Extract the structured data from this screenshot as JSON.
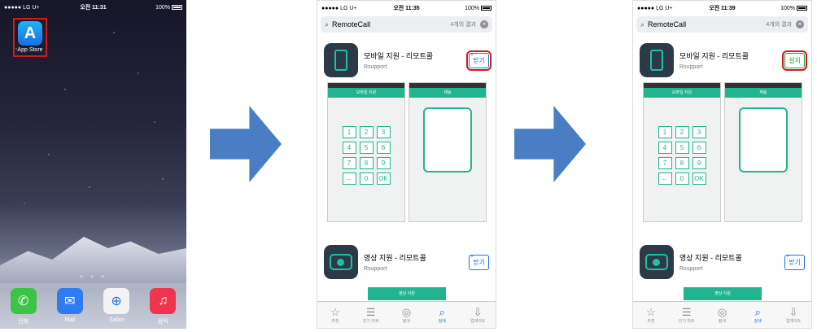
{
  "phone1": {
    "status": {
      "carrier": "●●●●● LG U+",
      "time": "오전 11:31",
      "battery": "100%"
    },
    "app_store_label": "App Store",
    "page_dots": "● ● ●",
    "dock": [
      {
        "label": "전화",
        "icon": "phone-icon",
        "color": "#3cc446",
        "glyph": "✆"
      },
      {
        "label": "Mail",
        "icon": "mail-icon",
        "color": "#2f7cf0",
        "glyph": "✉"
      },
      {
        "label": "Safari",
        "icon": "safari-icon",
        "color": "#f3f3f3",
        "glyph": "⊕"
      },
      {
        "label": "음악",
        "icon": "music-icon",
        "color": "#f0344f",
        "glyph": "♫"
      }
    ]
  },
  "phone2": {
    "status": {
      "carrier": "●●●●● LG U+",
      "time": "오전 11:35",
      "battery": "100%"
    },
    "search": {
      "query": "RemoteCall",
      "count": "4개의 결과"
    },
    "app1": {
      "title": "모바일 지원 - 리모트콜",
      "developer": "Rsupport",
      "button": "받기"
    },
    "app2": {
      "title": "영상 지원 - 리모트콜",
      "developer": "Rsupport",
      "button": "받기"
    },
    "shot_header_left": "모바일 지원",
    "shot_header_right": "채팅",
    "mini_header": "영상 지원"
  },
  "phone3": {
    "status": {
      "carrier": "●●●●● LG U+",
      "time": "오전 11:39",
      "battery": "100%"
    },
    "search": {
      "query": "RemoteCall",
      "count": "4개의 결과"
    },
    "app1": {
      "title": "모바일 지원 - 리모트콜",
      "developer": "Rsupport",
      "button": "설치"
    },
    "app2": {
      "title": "영상 지원 - 리모트콜",
      "developer": "Rsupport",
      "button": "받기"
    },
    "shot_header_left": "모바일 지원",
    "shot_header_right": "채팅",
    "mini_header": "영상 지원"
  },
  "keypad": [
    "1",
    "2",
    "3",
    "4",
    "5",
    "6",
    "7",
    "8",
    "9",
    "←",
    "0",
    "OK"
  ],
  "tabs": [
    {
      "label": "추천",
      "glyph": "☆",
      "icon": "star-icon"
    },
    {
      "label": "인기 차트",
      "glyph": "☰",
      "icon": "list-icon"
    },
    {
      "label": "탐색",
      "glyph": "◎",
      "icon": "compass-icon"
    },
    {
      "label": "검색",
      "glyph": "⌕",
      "icon": "search-icon"
    },
    {
      "label": "업데이트",
      "glyph": "⇩",
      "icon": "update-icon"
    }
  ]
}
